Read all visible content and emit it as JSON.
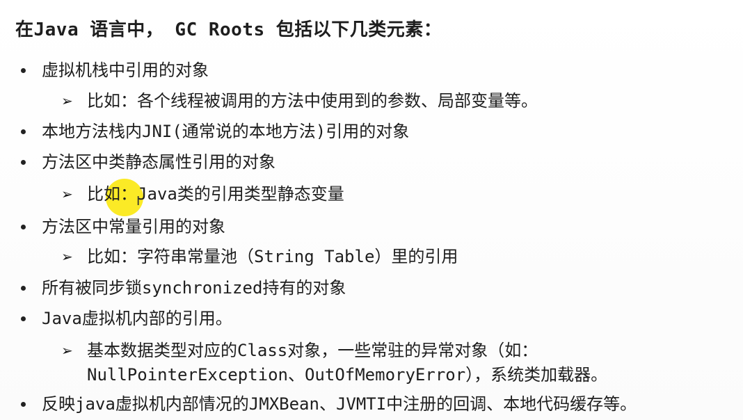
{
  "title": "在Java 语言中， GC Roots 包括以下几类元素：",
  "items": [
    {
      "level": 1,
      "text": "虚拟机栈中引用的对象"
    },
    {
      "level": 2,
      "text": "比如：各个线程被调用的方法中使用到的参数、局部变量等。"
    },
    {
      "level": 1,
      "text": "本地方法栈内JNI(通常说的本地方法)引用的对象"
    },
    {
      "level": 1,
      "text": "方法区中类静态属性引用的对象"
    },
    {
      "level": 2,
      "text": "比如：Java类的引用类型静态变量"
    },
    {
      "level": 1,
      "text": "方法区中常量引用的对象"
    },
    {
      "level": 2,
      "text": "比如：字符串常量池（String Table）里的引用"
    },
    {
      "level": 1,
      "text": "所有被同步锁synchronized持有的对象"
    },
    {
      "level": 1,
      "text": "Java虚拟机内部的引用。"
    },
    {
      "level": 2,
      "text": "基本数据类型对应的Class对象，一些常驻的异常对象（如："
    },
    {
      "level": 3,
      "text": "NullPointerException、OutOfMemoryError），系统类加载器。"
    },
    {
      "level": 1,
      "text": "反映java虚拟机内部情况的JMXBean、JVMTI中注册的回调、本地代码缓存等。"
    }
  ],
  "cursor_icon": "text-ibeam-cursor",
  "highlight_color": "#fae600"
}
